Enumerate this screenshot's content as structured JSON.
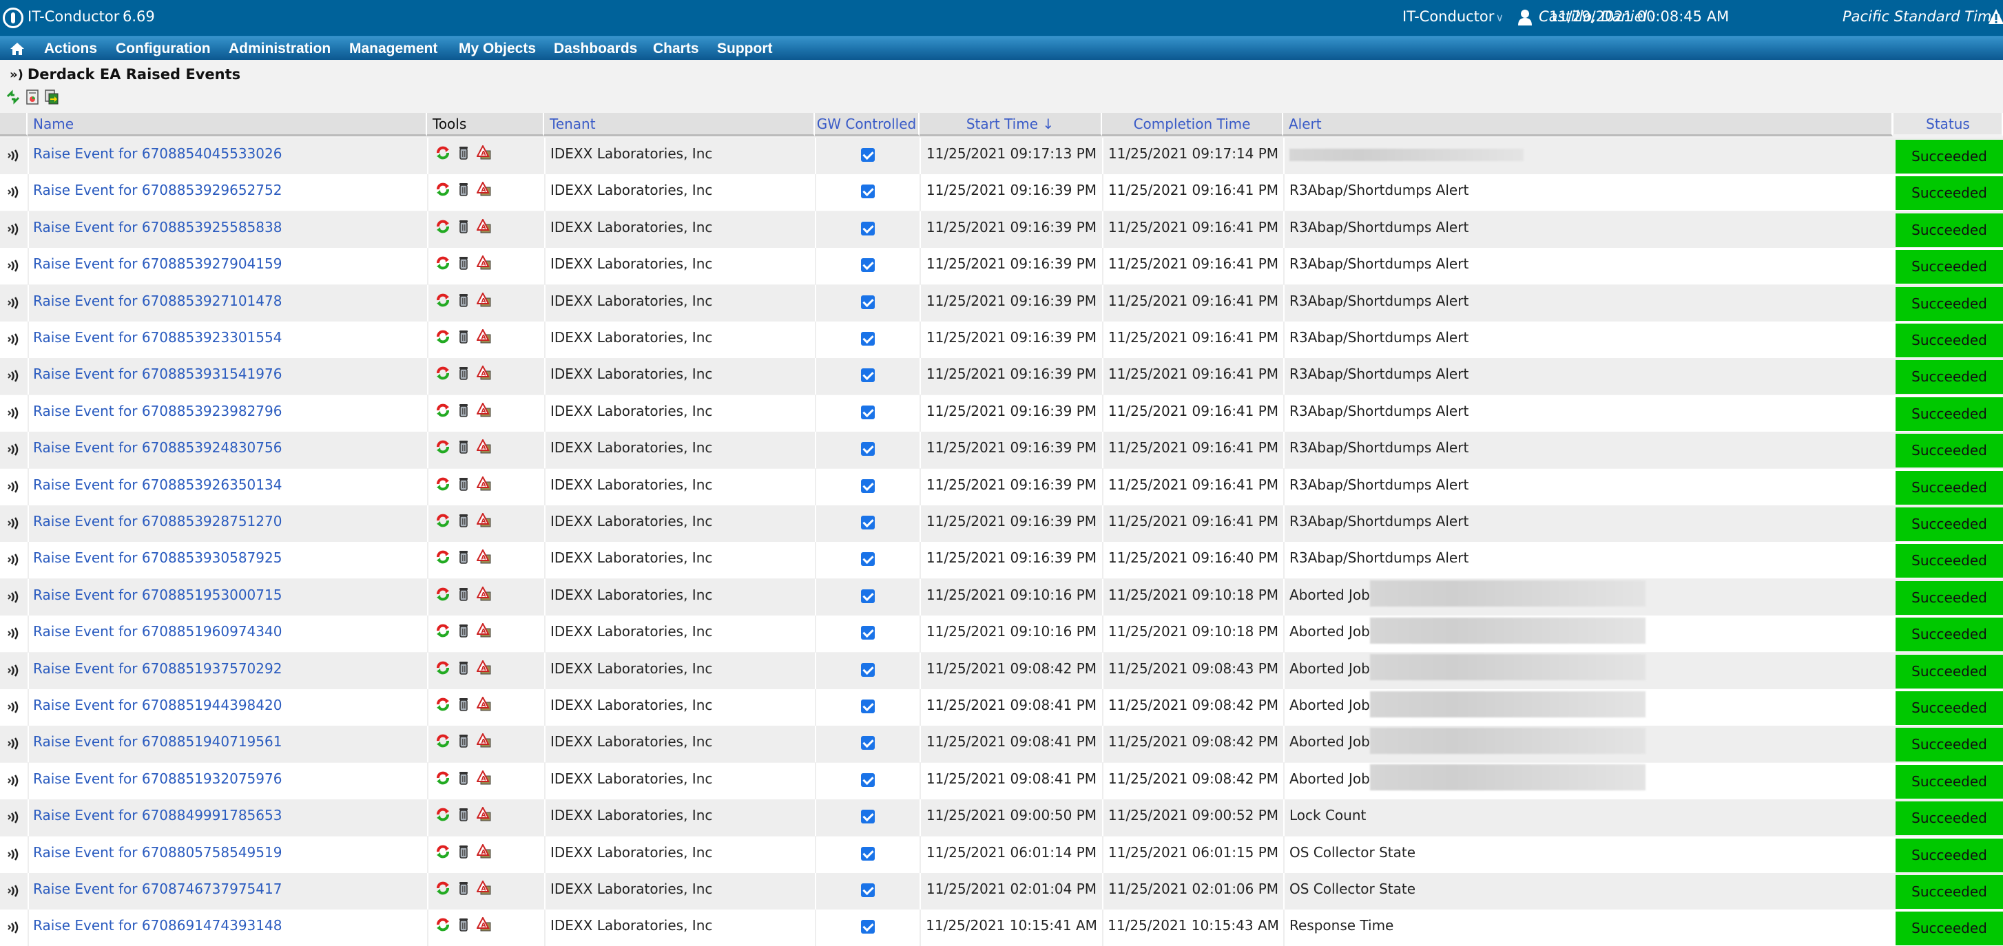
{
  "header": {
    "app_title": "IT-Conductor",
    "version": "6.69",
    "tenant_selector": "IT-Conductor",
    "user_name": "Castillo, Daniel",
    "datetime": "11/29/2021 00:08:45 AM",
    "timezone": "Pacific Standard Time"
  },
  "nav": {
    "items": [
      "Actions",
      "Configuration",
      "Administration",
      "Management",
      "My Objects",
      "Dashboards",
      "Charts",
      "Support"
    ]
  },
  "page": {
    "title": "Derdack EA Raised Events"
  },
  "table": {
    "columns": {
      "name": "Name",
      "tools": "Tools",
      "tenant": "Tenant",
      "gw": "GW Controlled",
      "start": "Start Time ↓",
      "completion": "Completion Time",
      "alert": "Alert",
      "status": "Status"
    },
    "rows": [
      {
        "name": "Raise Event for 6708854045533026",
        "tenant": "IDEXX Laboratories, Inc",
        "gw": true,
        "start": "11/25/2021 09:17:13 PM",
        "completion": "11/25/2021 09:17:14 PM",
        "alert": "",
        "alert_redacted": true,
        "status": "Succeeded"
      },
      {
        "name": "Raise Event for 6708853929652752",
        "tenant": "IDEXX Laboratories, Inc",
        "gw": true,
        "start": "11/25/2021 09:16:39 PM",
        "completion": "11/25/2021 09:16:41 PM",
        "alert": "R3Abap/Shortdumps Alert",
        "status": "Succeeded"
      },
      {
        "name": "Raise Event for 6708853925585838",
        "tenant": "IDEXX Laboratories, Inc",
        "gw": true,
        "start": "11/25/2021 09:16:39 PM",
        "completion": "11/25/2021 09:16:41 PM",
        "alert": "R3Abap/Shortdumps Alert",
        "status": "Succeeded"
      },
      {
        "name": "Raise Event for 6708853927904159",
        "tenant": "IDEXX Laboratories, Inc",
        "gw": true,
        "start": "11/25/2021 09:16:39 PM",
        "completion": "11/25/2021 09:16:41 PM",
        "alert": "R3Abap/Shortdumps Alert",
        "status": "Succeeded"
      },
      {
        "name": "Raise Event for 6708853927101478",
        "tenant": "IDEXX Laboratories, Inc",
        "gw": true,
        "start": "11/25/2021 09:16:39 PM",
        "completion": "11/25/2021 09:16:41 PM",
        "alert": "R3Abap/Shortdumps Alert",
        "status": "Succeeded"
      },
      {
        "name": "Raise Event for 6708853923301554",
        "tenant": "IDEXX Laboratories, Inc",
        "gw": true,
        "start": "11/25/2021 09:16:39 PM",
        "completion": "11/25/2021 09:16:41 PM",
        "alert": "R3Abap/Shortdumps Alert",
        "status": "Succeeded"
      },
      {
        "name": "Raise Event for 6708853931541976",
        "tenant": "IDEXX Laboratories, Inc",
        "gw": true,
        "start": "11/25/2021 09:16:39 PM",
        "completion": "11/25/2021 09:16:41 PM",
        "alert": "R3Abap/Shortdumps Alert",
        "status": "Succeeded"
      },
      {
        "name": "Raise Event for 6708853923982796",
        "tenant": "IDEXX Laboratories, Inc",
        "gw": true,
        "start": "11/25/2021 09:16:39 PM",
        "completion": "11/25/2021 09:16:41 PM",
        "alert": "R3Abap/Shortdumps Alert",
        "status": "Succeeded"
      },
      {
        "name": "Raise Event for 6708853924830756",
        "tenant": "IDEXX Laboratories, Inc",
        "gw": true,
        "start": "11/25/2021 09:16:39 PM",
        "completion": "11/25/2021 09:16:41 PM",
        "alert": "R3Abap/Shortdumps Alert",
        "status": "Succeeded"
      },
      {
        "name": "Raise Event for 6708853926350134",
        "tenant": "IDEXX Laboratories, Inc",
        "gw": true,
        "start": "11/25/2021 09:16:39 PM",
        "completion": "11/25/2021 09:16:41 PM",
        "alert": "R3Abap/Shortdumps Alert",
        "status": "Succeeded"
      },
      {
        "name": "Raise Event for 6708853928751270",
        "tenant": "IDEXX Laboratories, Inc",
        "gw": true,
        "start": "11/25/2021 09:16:39 PM",
        "completion": "11/25/2021 09:16:41 PM",
        "alert": "R3Abap/Shortdumps Alert",
        "status": "Succeeded"
      },
      {
        "name": "Raise Event for 6708853930587925",
        "tenant": "IDEXX Laboratories, Inc",
        "gw": true,
        "start": "11/25/2021 09:16:39 PM",
        "completion": "11/25/2021 09:16:40 PM",
        "alert": "R3Abap/Shortdumps Alert",
        "status": "Succeeded"
      },
      {
        "name": "Raise Event for 6708851953000715",
        "tenant": "IDEXX Laboratories, Inc",
        "gw": true,
        "start": "11/25/2021 09:10:16 PM",
        "completion": "11/25/2021 09:10:18 PM",
        "alert": "Aborted Job",
        "alert_redacted": true,
        "status": "Succeeded"
      },
      {
        "name": "Raise Event for 6708851960974340",
        "tenant": "IDEXX Laboratories, Inc",
        "gw": true,
        "start": "11/25/2021 09:10:16 PM",
        "completion": "11/25/2021 09:10:18 PM",
        "alert": "Aborted Job",
        "alert_redacted": true,
        "status": "Succeeded"
      },
      {
        "name": "Raise Event for 6708851937570292",
        "tenant": "IDEXX Laboratories, Inc",
        "gw": true,
        "start": "11/25/2021 09:08:42 PM",
        "completion": "11/25/2021 09:08:43 PM",
        "alert": "Aborted Job",
        "alert_redacted": true,
        "status": "Succeeded"
      },
      {
        "name": "Raise Event for 6708851944398420",
        "tenant": "IDEXX Laboratories, Inc",
        "gw": true,
        "start": "11/25/2021 09:08:41 PM",
        "completion": "11/25/2021 09:08:42 PM",
        "alert": "Aborted Job",
        "alert_redacted": true,
        "status": "Succeeded"
      },
      {
        "name": "Raise Event for 6708851940719561",
        "tenant": "IDEXX Laboratories, Inc",
        "gw": true,
        "start": "11/25/2021 09:08:41 PM",
        "completion": "11/25/2021 09:08:42 PM",
        "alert": "Aborted Job",
        "alert_redacted": true,
        "status": "Succeeded"
      },
      {
        "name": "Raise Event for 6708851932075976",
        "tenant": "IDEXX Laboratories, Inc",
        "gw": true,
        "start": "11/25/2021 09:08:41 PM",
        "completion": "11/25/2021 09:08:42 PM",
        "alert": "Aborted Job",
        "alert_redacted": true,
        "status": "Succeeded"
      },
      {
        "name": "Raise Event for 6708849991785653",
        "tenant": "IDEXX Laboratories, Inc",
        "gw": true,
        "start": "11/25/2021 09:00:50 PM",
        "completion": "11/25/2021 09:00:52 PM",
        "alert": "Lock Count",
        "status": "Succeeded"
      },
      {
        "name": "Raise Event for 6708805758549519",
        "tenant": "IDEXX Laboratories, Inc",
        "gw": true,
        "start": "11/25/2021 06:01:14 PM",
        "completion": "11/25/2021 06:01:15 PM",
        "alert": "OS Collector State",
        "status": "Succeeded"
      },
      {
        "name": "Raise Event for 6708746737975417",
        "tenant": "IDEXX Laboratories, Inc",
        "gw": true,
        "start": "11/25/2021 02:01:04 PM",
        "completion": "11/25/2021 02:01:06 PM",
        "alert": "OS Collector State",
        "status": "Succeeded"
      },
      {
        "name": "Raise Event for 6708691474393148",
        "tenant": "IDEXX Laboratories, Inc",
        "gw": true,
        "start": "11/25/2021 10:15:41 AM",
        "completion": "11/25/2021 10:15:43 AM",
        "alert": "Response Time",
        "status": "Succeeded"
      }
    ]
  },
  "colors": {
    "topbar": "#00629a",
    "link": "#2a5bbf",
    "status_succeeded": "#00c800",
    "checkbox": "#1a73e8"
  }
}
